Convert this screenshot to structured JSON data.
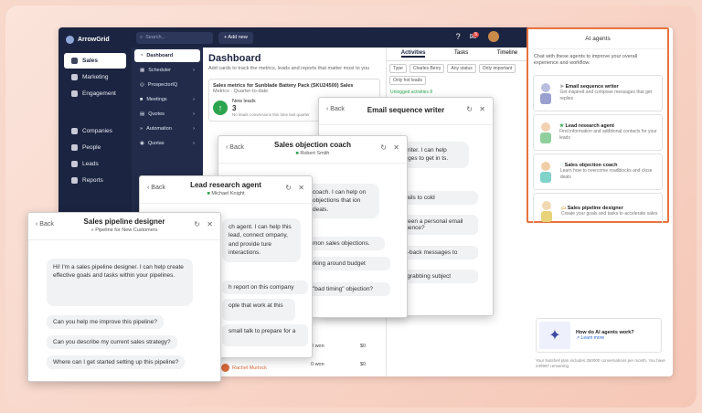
{
  "app": {
    "brand": "ArrowGrid",
    "search_placeholder": "Search...",
    "add_new": "+ Add new",
    "notif_count": "5"
  },
  "nav": {
    "primary": [
      "Sales",
      "Marketing",
      "Engagement"
    ],
    "secondary": [
      "Companies",
      "People",
      "Leads",
      "Reports"
    ]
  },
  "subnav": [
    "Dashboard",
    "Scheduler",
    "ProspectorIQ",
    "Meetings",
    "Quotes",
    "Automation",
    "Quotas"
  ],
  "dashboard": {
    "title": "Dashboard",
    "subtitle": "Add cards to track the metrics, leads and reports that matter most to you",
    "card_title": "Sales metrics for Sunblade Battery Pack (SKU24500) Sales",
    "card_sub": "Metrics · Quarter-to-date",
    "metric_label": "New leads",
    "metric_value": "3",
    "metric_note": "No leads conversions this time last quarter",
    "row_won": [
      "0 won",
      "0 won"
    ],
    "row_amount": [
      "$0",
      "$0"
    ],
    "row_person": "Rachel Murlock"
  },
  "activity": {
    "tabs": [
      "Activities",
      "Tasks",
      "Timeline"
    ],
    "filters": [
      "Type",
      "Charles Berry",
      "Any status",
      "Only important",
      "Only hot leads"
    ],
    "unlogged": "Unlogged activities 8"
  },
  "ai": {
    "title": "AI agents",
    "desc": "Chat with these agents to improve your overall experience and workflow",
    "agents": [
      {
        "name": "Email sequence writer",
        "desc": "Get inspired and compose messages that get replies",
        "icon": "send-icon"
      },
      {
        "name": "Lead research agent",
        "desc": "Find information and additional contacts for your leads",
        "icon": "star-icon"
      },
      {
        "name": "Sales objection coach",
        "desc": "Learn how to overcome roadblocks and close deals",
        "icon": "chat-icon"
      },
      {
        "name": "Sales pipeline designer",
        "desc": "Create your goals and tasks to accelerate sales",
        "icon": "folder-icon"
      }
    ],
    "how_title": "How do AI agents work?",
    "learn_more": "Learn more",
    "plan_note": "Your Nutshell plan includes 250000 conversations per month. You have 249997 remaining."
  },
  "dialogs": {
    "back": "Back",
    "email": {
      "title": "Email sequence writer",
      "bubble": "e writer. I can help ssages to get in ts.",
      "s1": " emails to cold",
      "s2": "etween a personal email equence?",
      "s3": " win-back messages to",
      "s4": "on-grabbing subject"
    },
    "objection": {
      "title": "Sales objection coach",
      "person": "Robert Smith",
      "bubble": "coach. I can help on objections that ion deals.",
      "s1": "mon sales objections.",
      "s2": "rking around budget",
      "s3": "\"bad timing\" objection?"
    },
    "lead": {
      "title": "Lead research agent",
      "person": "Michael Knight",
      "bubble": "ch agent. I can help this lead, connect ompany, and provide ture interactions.",
      "s1": "h report on this company",
      "s2": "ople that work at this",
      "s3": " small talk to prepare for a"
    },
    "pipeline": {
      "title": "Sales pipeline designer",
      "sub": "Pipeline for New Customers",
      "bubble": "Hi! I'm a sales pipeline designer. I can help create effective goals and tasks within your pipelines.",
      "s1": "Can you help me improve this pipeline?",
      "s2": "Can you describe my current sales strategy?",
      "s3": "Where can I get started setting up this pipeline?"
    }
  },
  "colors": {
    "accent": "#e8733e",
    "nav": "#1b2440",
    "green": "#2da44e"
  }
}
